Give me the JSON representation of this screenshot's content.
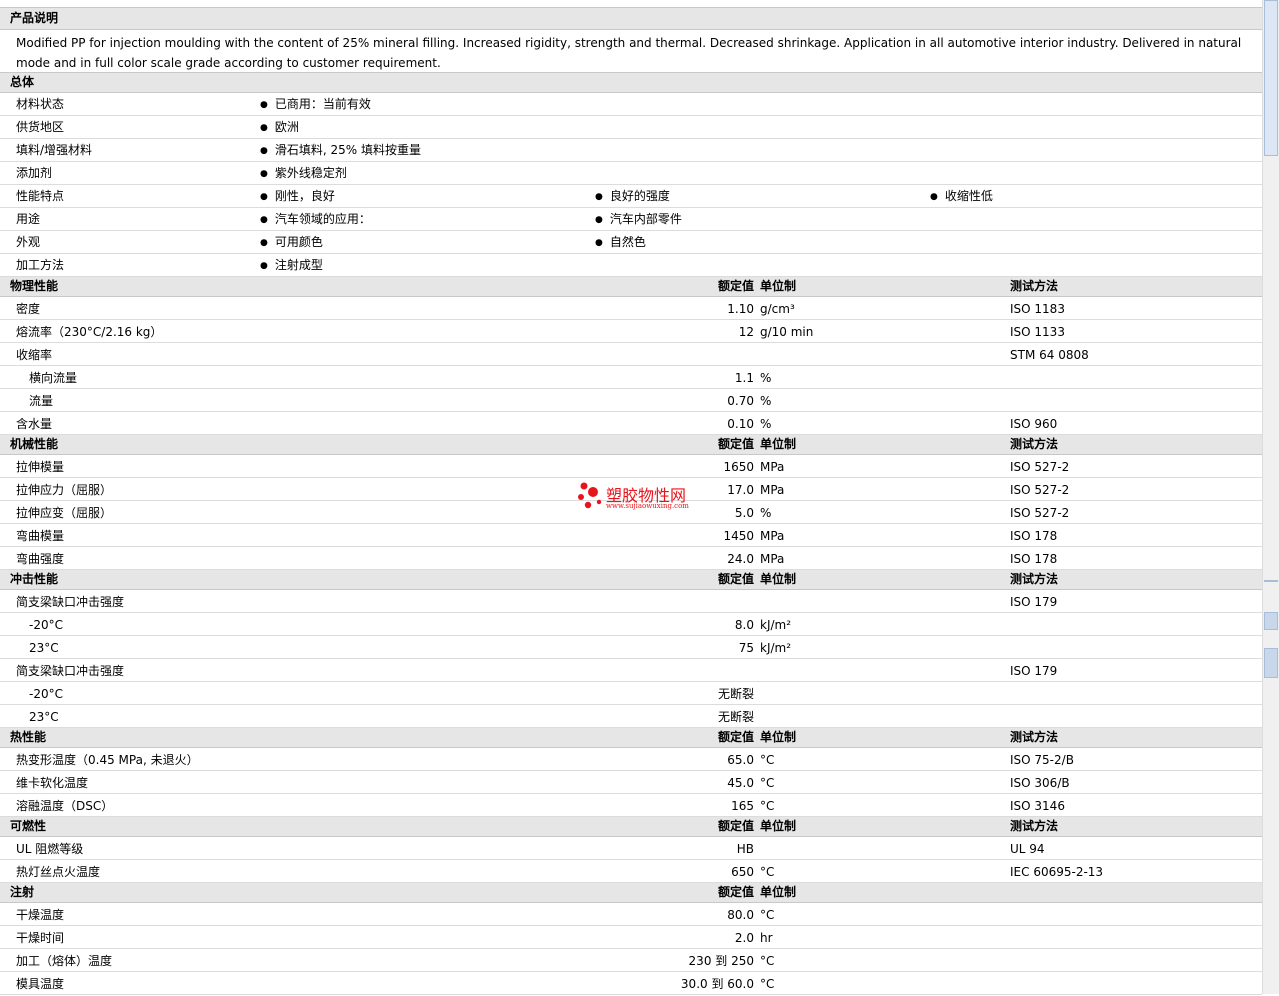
{
  "desc_section": {
    "title": "产品说明",
    "text": "Modified PP for injection moulding with the content of 25% mineral filling. Increased rigidity, strength and thermal. Decreased shrinkage. Application in all automotive interior industry. Delivered in natural mode and in full color scale grade according to customer requirement."
  },
  "general": {
    "title": "总体",
    "rows": [
      {
        "label": "材料状态",
        "items": [
          "已商用：当前有效"
        ]
      },
      {
        "label": "供货地区",
        "items": [
          "欧洲"
        ]
      },
      {
        "label": "填料/增强材料",
        "items": [
          "滑石填料, 25% 填料按重量"
        ]
      },
      {
        "label": "添加剂",
        "items": [
          "紫外线稳定剂"
        ]
      },
      {
        "label": "性能特点",
        "items": [
          "刚性，良好",
          "良好的强度",
          "收缩性低"
        ]
      },
      {
        "label": "用途",
        "items": [
          "汽车领域的应用：",
          "汽车内部零件"
        ]
      },
      {
        "label": "外观",
        "items": [
          "可用颜色",
          "自然色"
        ]
      },
      {
        "label": "加工方法",
        "items": [
          "注射成型"
        ]
      }
    ]
  },
  "col_headers": {
    "value": "额定值",
    "unit": "单位制",
    "method": "测试方法"
  },
  "physical": {
    "title": "物理性能",
    "rows": [
      {
        "label": "密度",
        "value": "1.10",
        "unit": "g/cm³",
        "method": "ISO 1183"
      },
      {
        "label": "熔流率（230°C/2.16 kg）",
        "value": "12",
        "unit": "g/10 min",
        "method": "ISO 1133"
      },
      {
        "label": "收缩率",
        "method": "STM 64 0808"
      },
      {
        "label": "横向流量",
        "value": "1.1",
        "unit": "%",
        "sub": true
      },
      {
        "label": "流量",
        "value": "0.70",
        "unit": "%",
        "sub": true
      },
      {
        "label": "含水量",
        "value": "0.10",
        "unit": "%",
        "method": "ISO 960"
      }
    ]
  },
  "mechanical": {
    "title": "机械性能",
    "rows": [
      {
        "label": "拉伸模量",
        "value": "1650",
        "unit": "MPa",
        "method": "ISO 527-2"
      },
      {
        "label": "拉伸应力（屈服）",
        "value": "17.0",
        "unit": "MPa",
        "method": "ISO 527-2"
      },
      {
        "label": "拉伸应变（屈服）",
        "value": "5.0",
        "unit": "%",
        "method": "ISO 527-2"
      },
      {
        "label": "弯曲模量",
        "value": "1450",
        "unit": "MPa",
        "method": "ISO 178"
      },
      {
        "label": "弯曲强度",
        "value": "24.0",
        "unit": "MPa",
        "method": "ISO 178"
      }
    ]
  },
  "impact": {
    "title": "冲击性能",
    "rows": [
      {
        "label": "简支梁缺口冲击强度",
        "method": "ISO 179"
      },
      {
        "label": "-20°C",
        "value": "8.0",
        "unit": "kJ/m²",
        "sub": true
      },
      {
        "label": "23°C",
        "value": "75",
        "unit": "kJ/m²",
        "sub": true
      },
      {
        "label": "简支梁缺口冲击强度",
        "method": "ISO 179"
      },
      {
        "label": "-20°C",
        "value": "无断裂",
        "sub": true
      },
      {
        "label": "23°C",
        "value": "无断裂",
        "sub": true
      }
    ]
  },
  "thermal": {
    "title": "热性能",
    "rows": [
      {
        "label": "热变形温度（0.45 MPa, 未退火）",
        "value": "65.0",
        "unit": "°C",
        "method": "ISO 75-2/B"
      },
      {
        "label": "维卡软化温度",
        "value": "45.0",
        "unit": "°C",
        "method": "ISO 306/B"
      },
      {
        "label": "溶融温度（DSC）",
        "value": "165",
        "unit": "°C",
        "method": "ISO 3146"
      }
    ]
  },
  "flammability": {
    "title": "可燃性",
    "rows": [
      {
        "label": "UL 阻燃等级",
        "value": "HB",
        "method": "UL 94"
      },
      {
        "label": "热灯丝点火温度",
        "value": "650",
        "unit": "°C",
        "method": "IEC 60695-2-13"
      }
    ]
  },
  "injection": {
    "title": "注射",
    "rows": [
      {
        "label": "干燥温度",
        "value": "80.0",
        "unit": "°C"
      },
      {
        "label": "干燥时间",
        "value": "2.0",
        "unit": "hr"
      },
      {
        "label": "加工（熔体）温度",
        "value": "230 到  250",
        "unit": "°C"
      },
      {
        "label": "模具温度",
        "value": "30.0 到  60.0",
        "unit": "°C"
      }
    ]
  },
  "watermark": {
    "title": "塑胶物性网",
    "url": "www.sujiaowuxing.com"
  }
}
